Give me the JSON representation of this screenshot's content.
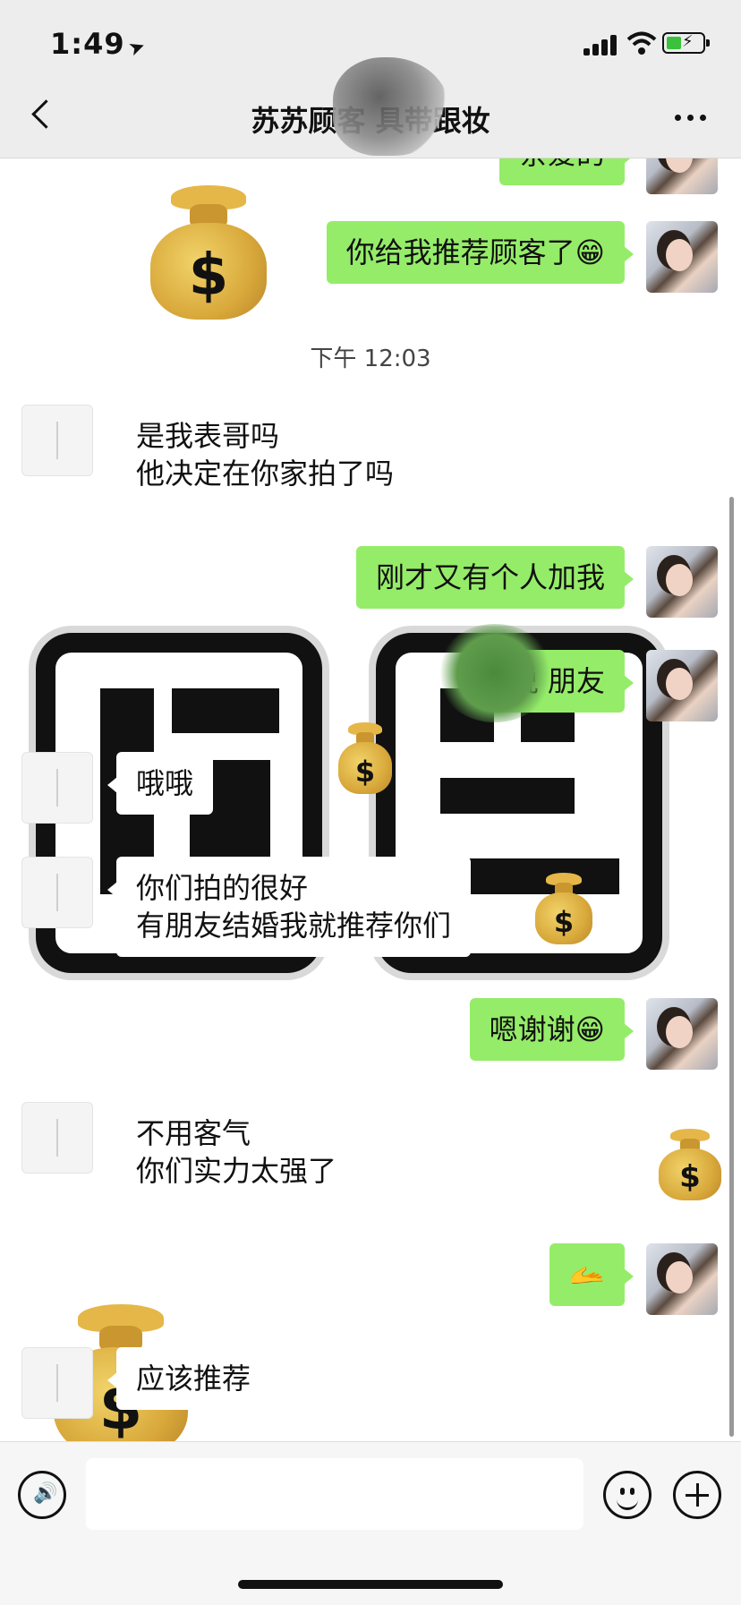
{
  "status": {
    "time": "1:49",
    "location_icon": "location-arrow-icon"
  },
  "header": {
    "title": "苏苏顾客          具带跟妆",
    "back_icon": "chevron-left-icon",
    "more_icon": "more-dots-icon"
  },
  "chat": {
    "timestamp": "下午 12:03",
    "messages": [
      {
        "side": "me",
        "type": "text",
        "text": "亲爱的"
      },
      {
        "side": "me",
        "type": "text",
        "text": "你给我推荐顾客了😁"
      },
      {
        "side": "other",
        "type": "text",
        "text": "是我表哥吗\n他决定在你家拍了吗"
      },
      {
        "side": "me",
        "type": "text",
        "text": "刚才又有个人加我"
      },
      {
        "side": "me",
        "type": "text",
        "text": "说    朋友"
      },
      {
        "side": "other",
        "type": "text",
        "text": "哦哦"
      },
      {
        "side": "other",
        "type": "text",
        "text": "你们拍的很好\n有朋友结婚我就推荐你们"
      },
      {
        "side": "me",
        "type": "text",
        "text": "嗯谢谢😁"
      },
      {
        "side": "other",
        "type": "text",
        "text": "不用客气\n你们实力太强了"
      },
      {
        "side": "me",
        "type": "sticker",
        "text": "🫴"
      },
      {
        "side": "other",
        "type": "text",
        "text": "应该推荐"
      }
    ],
    "money_sign": "$"
  },
  "input": {
    "value": "",
    "placeholder": ""
  },
  "colors": {
    "my_bubble": "#95ec69",
    "other_bubble": "#ffffff",
    "header_bg": "#ededed"
  }
}
